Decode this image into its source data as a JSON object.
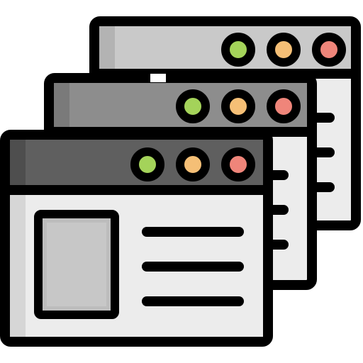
{
  "icon": {
    "name": "stacked-browser-windows-icon",
    "colors": {
      "outline": "#000000",
      "back_window_titlebar": "#c9c9c9",
      "back_window_body": "#ececec",
      "middle_window_titlebar": "#8d8d8d",
      "middle_window_body": "#ececec",
      "front_window_titlebar": "#5f5f5f",
      "front_window_body": "#e3e3e3",
      "image_placeholder_fill": "#bdbdbd",
      "green_dot": "#a4d35a",
      "yellow_dot": "#f5bf76",
      "red_dot": "#ef857a"
    },
    "windows": [
      {
        "id": "back",
        "dots": [
          "green",
          "yellow",
          "red"
        ]
      },
      {
        "id": "middle",
        "dots": [
          "green",
          "yellow",
          "red"
        ]
      },
      {
        "id": "front",
        "dots": [
          "green",
          "yellow",
          "red"
        ]
      }
    ]
  }
}
